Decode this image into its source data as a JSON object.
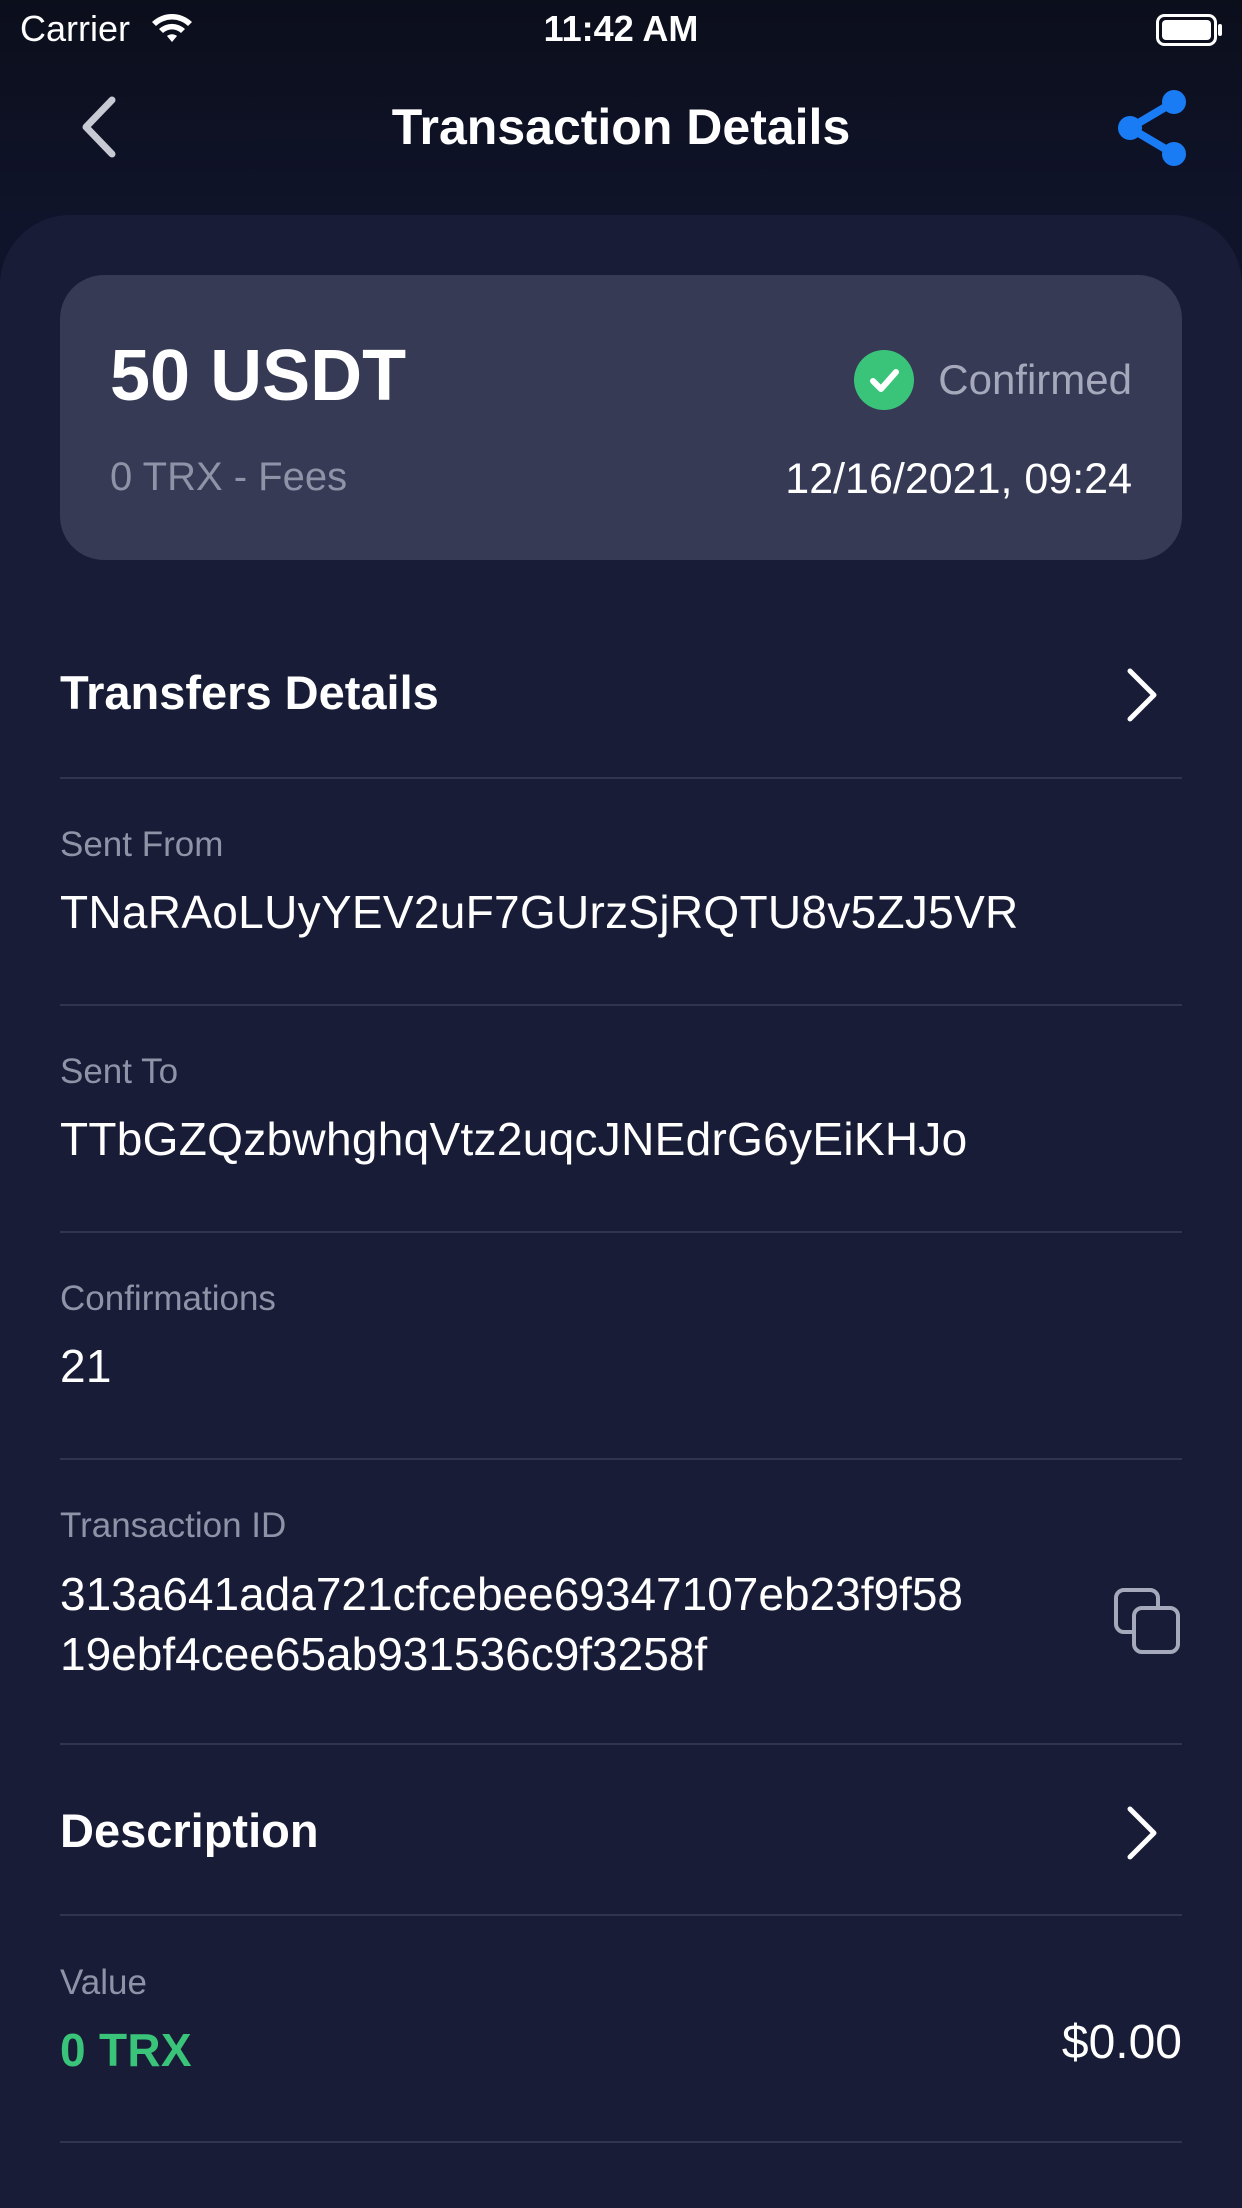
{
  "status_bar": {
    "carrier": "Carrier",
    "time": "11:42 AM"
  },
  "nav": {
    "title": "Transaction Details"
  },
  "summary": {
    "amount": "50 USDT",
    "fees": "0 TRX - Fees",
    "status": "Confirmed",
    "date": "12/16/2021, 09:24"
  },
  "transfers": {
    "heading": "Transfers Details"
  },
  "sent_from": {
    "label": "Sent From",
    "value": "TNaRAoLUyYEV2uF7GUrzSjRQTU8v5ZJ5VR"
  },
  "sent_to": {
    "label": "Sent To",
    "value": "TTbGZQzbwhghqVtz2uqcJNEdrG6yEiKHJo"
  },
  "confirmations": {
    "label": "Confirmations",
    "value": "21"
  },
  "transaction_id": {
    "label": "Transaction ID",
    "line1": "313a641ada721cfcebee69347107eb23f9f58",
    "line2": "19ebf4cee65ab931536c9f3258f"
  },
  "description": {
    "heading": "Description"
  },
  "value": {
    "label": "Value",
    "crypto": "0 TRX",
    "fiat": "$0.00"
  },
  "colors": {
    "accent": "#1a7cf5",
    "success": "#3ac47a"
  },
  "icons": [
    "wifi-icon",
    "battery-icon",
    "back-chevron-icon",
    "share-icon",
    "check-circle-icon",
    "chevron-right-icon",
    "copy-icon"
  ]
}
